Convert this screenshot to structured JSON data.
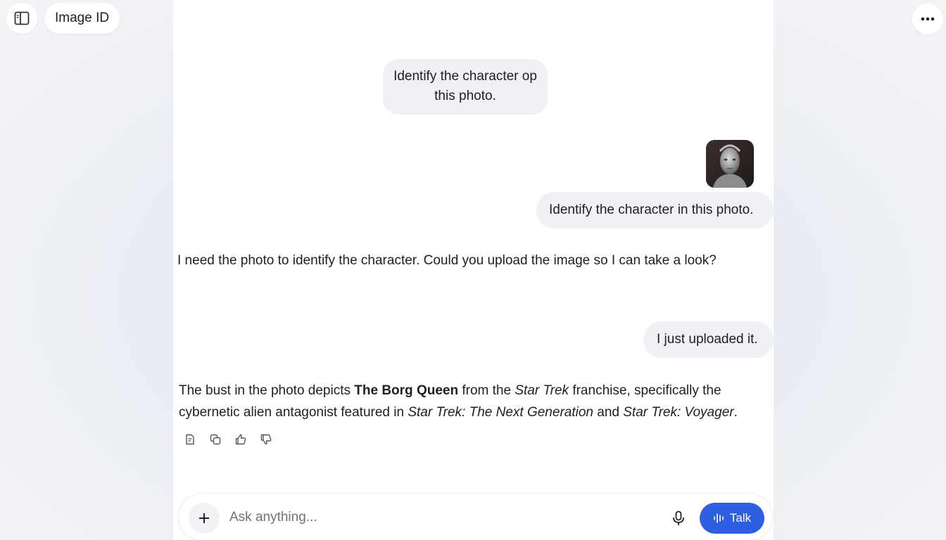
{
  "header": {
    "title": "Image ID",
    "sidebar_icon": "sidebar-toggle-icon",
    "more_icon": "more-horizontal-icon"
  },
  "conversation": {
    "user_message_1": "Identify the character op this photo.",
    "user_image_alt": "Borg Queen bust",
    "user_message_2": "Identify the character in this photo.",
    "assistant_reply_1": "I need the photo to identify the character. Could you upload the image so I can take a look?",
    "user_message_3": "I just uploaded it.",
    "assistant_reply_2": {
      "p1": "The bust in the photo depicts ",
      "bold": "The Borg Queen",
      "p2": " from the ",
      "italic1": "Star Trek",
      "p3": " franchise, specifically the cybernetic alien antagonist featured in ",
      "italic2": "Star Trek: The Next Generation",
      "p4": " and ",
      "italic3": "Star Trek: Voyager",
      "p5": "."
    },
    "actions": [
      "copy-text-icon",
      "copy-icon",
      "thumbs-up-icon",
      "thumbs-down-icon"
    ]
  },
  "composer": {
    "placeholder": "Ask anything...",
    "talk_label": "Talk"
  },
  "colors": {
    "accent": "#2e5fe0",
    "bubble": "#eff1f5"
  }
}
